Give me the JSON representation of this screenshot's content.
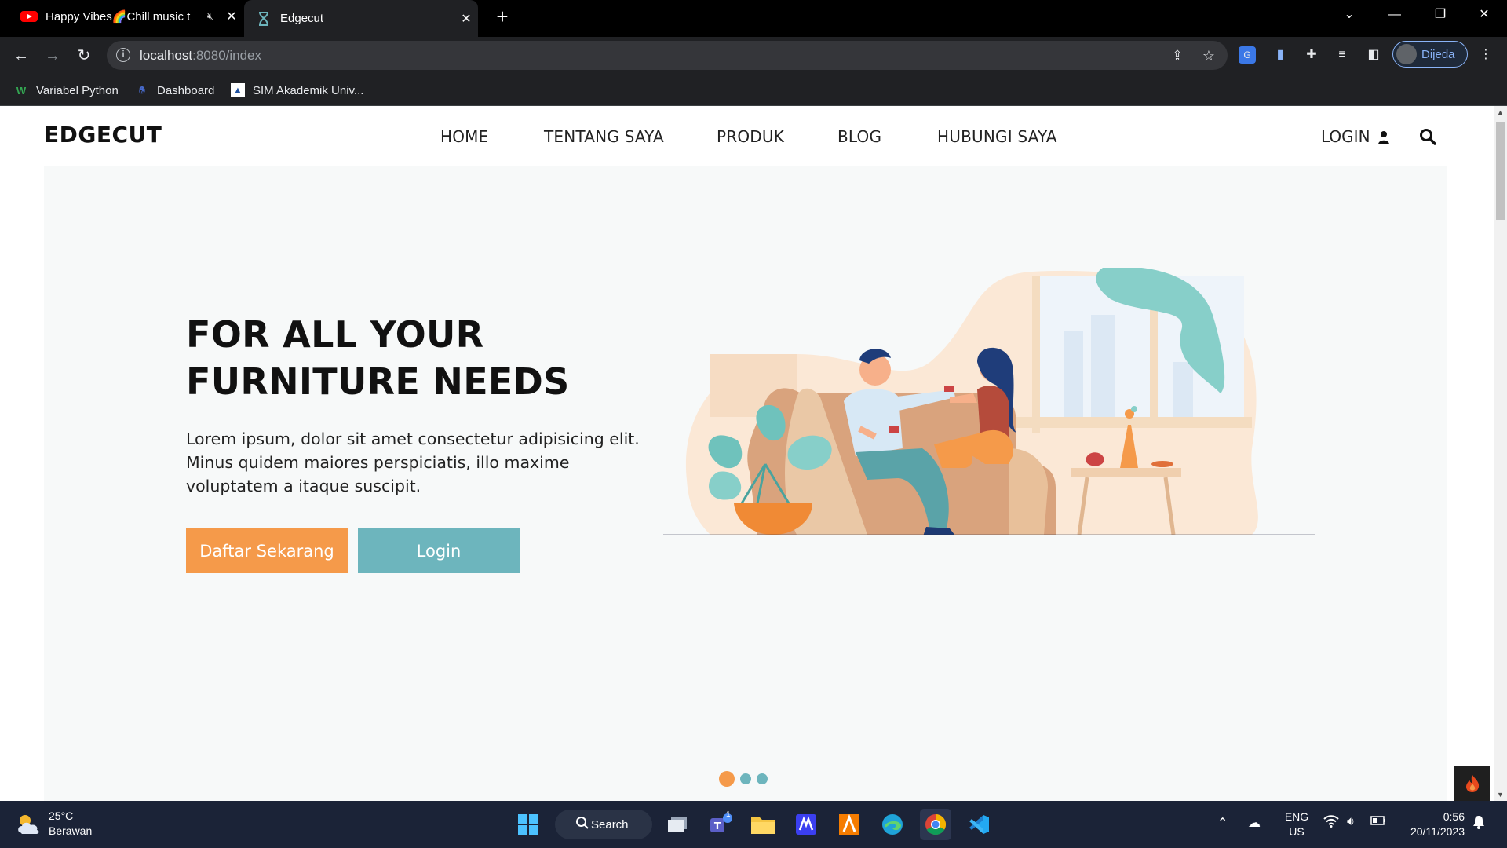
{
  "browser": {
    "tabs": [
      {
        "title": "Happy Vibes🌈Chill music t",
        "icon": "youtube-icon",
        "audio": "mute-icon"
      },
      {
        "title": "Edgecut",
        "icon": "hourglass-icon"
      }
    ],
    "new_tab": "+",
    "url_host": "localhost",
    "url_path": ":8080/index",
    "profile_name": "Dijeda",
    "bookmarks": [
      {
        "label": "Variabel Python",
        "icon": "w-icon"
      },
      {
        "label": "Dashboard",
        "icon": "hand-icon"
      },
      {
        "label": "SIM Akademik Univ...",
        "icon": "university-icon"
      }
    ]
  },
  "site": {
    "brand": "EDGECUT",
    "nav": [
      "HOME",
      "TENTANG SAYA",
      "PRODUK",
      "BLOG",
      "HUBUNGI SAYA"
    ],
    "login": "LOGIN",
    "hero": {
      "title_line1": "FOR ALL YOUR",
      "title_line2": "FURNITURE NEEDS",
      "lead": "Lorem ipsum, dolor sit amet consectetur adipisicing elit. Minus quidem maiores perspiciatis, illo maxime voluptatem a itaque suscipit.",
      "primary_button": "Daftar Sekarang",
      "secondary_button": "Login"
    },
    "carousel_active_index": 0,
    "carousel_count": 3
  },
  "colors": {
    "accent_orange": "#f59a4a",
    "accent_teal": "#6db5bd",
    "hero_bg": "#f7f9f9"
  },
  "taskbar": {
    "weather_temp": "25°C",
    "weather_desc": "Berawan",
    "search_label": "Search",
    "lang_line1": "ENG",
    "lang_line2": "US",
    "time": "0:56",
    "date": "20/11/2023",
    "teams_badge": "1"
  }
}
